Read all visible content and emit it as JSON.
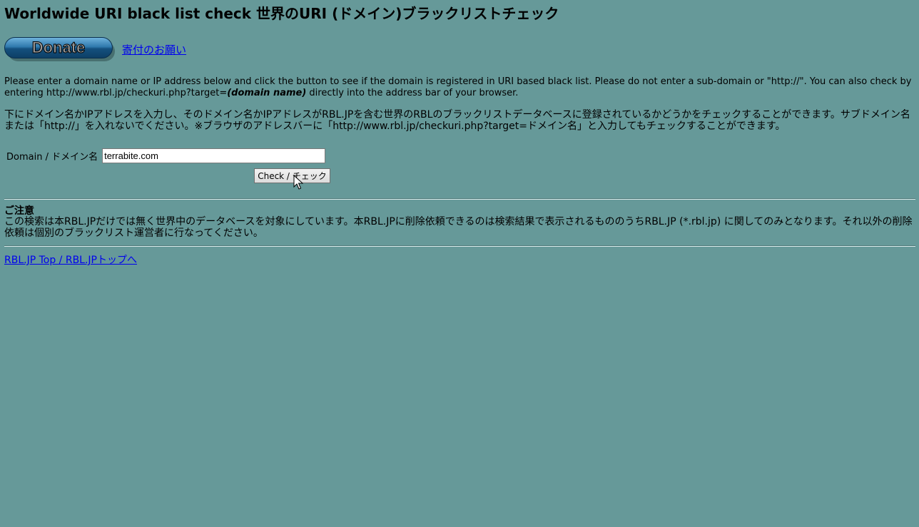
{
  "title": "Worldwide URI black list check 世界のURI (ドメイン)ブラックリストチェック",
  "donate": {
    "button_label": "Donate",
    "link_text": "寄付のお願い"
  },
  "description": {
    "en_before": "Please enter a domain name or IP address below and click the button to see if the domain is registered in URI based black list. Please do not enter a sub-domain or \"http://\". You can also check by entering http://www.rbl.jp/checkuri.php?target=",
    "en_emphasis": "(domain name)",
    "en_after": " directly into the address bar of your browser.",
    "ja": "下にドメイン名かIPアドレスを入力し、そのドメイン名かIPアドレスがRBL.JPを含む世界のRBLのブラックリストデータベースに登録されているかどうかをチェックすることができます。サブドメイン名または「http://」を入れないでください。※ブラウザのアドレスバーに「http://www.rbl.jp/checkuri.php?target=ドメイン名」と入力してもチェックすることができます。"
  },
  "form": {
    "label": "Domain / ドメイン名",
    "input_value": "terrabite.com",
    "button_label": "Check / チェック"
  },
  "notice": {
    "title": "ご注意",
    "body": "この検索は本RBL.JPだけでは無く世界中のデータベースを対象にしています。本RBL.JPに削除依頼できるのは検索結果で表示されるもののうちRBL.JP (*.rbl.jp) に関してのみとなります。それ以外の削除依頼は個別のブラックリスト運営者に行なってください。"
  },
  "footer": {
    "top_link": "RBL.JP Top / RBL.JPトップへ"
  },
  "colors": {
    "background": "#669999",
    "link": "#0000ee"
  }
}
